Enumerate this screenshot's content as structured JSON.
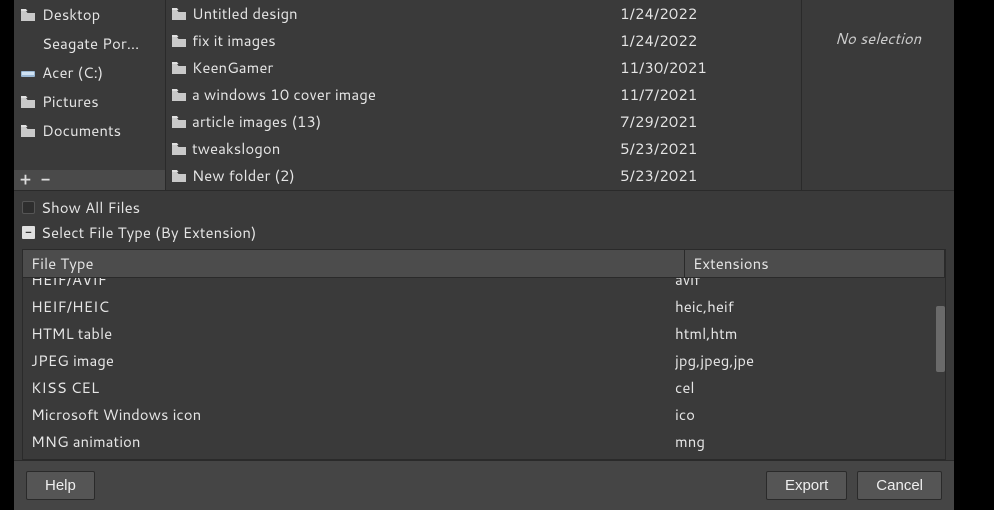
{
  "sidebar": {
    "items": [
      {
        "icon": "folder",
        "label": "Desktop"
      },
      {
        "icon": "none",
        "label": "Seagate Por…"
      },
      {
        "icon": "drive",
        "label": "Acer (C:)"
      },
      {
        "icon": "folder",
        "label": "Pictures"
      },
      {
        "icon": "folder",
        "label": "Documents"
      }
    ],
    "add_label": "+",
    "remove_label": "−"
  },
  "files": {
    "rows": [
      {
        "name": "Untitled design",
        "date": "1/24/2022"
      },
      {
        "name": "fix it images",
        "date": "1/24/2022"
      },
      {
        "name": "KeenGamer",
        "date": "11/30/2021"
      },
      {
        "name": "a windows 10 cover image",
        "date": "11/7/2021"
      },
      {
        "name": "article images (13)",
        "date": "7/29/2021"
      },
      {
        "name": "tweakslogon",
        "date": "5/23/2021"
      },
      {
        "name": "New folder (2)",
        "date": "5/23/2021"
      }
    ]
  },
  "preview": {
    "no_selection": "No selection"
  },
  "options": {
    "show_all_files_label": "Show All Files",
    "select_type_label": "Select File Type (By Extension)"
  },
  "typetable": {
    "header_name": "File Type",
    "header_ext": "Extensions",
    "rows": [
      {
        "name": "HEIF/AVIF",
        "ext": "avif"
      },
      {
        "name": "HEIF/HEIC",
        "ext": "heic,heif"
      },
      {
        "name": "HTML table",
        "ext": "html,htm"
      },
      {
        "name": "JPEG image",
        "ext": "jpg,jpeg,jpe"
      },
      {
        "name": "KISS CEL",
        "ext": "cel"
      },
      {
        "name": "Microsoft Windows icon",
        "ext": "ico"
      },
      {
        "name": "MNG animation",
        "ext": "mng"
      }
    ]
  },
  "footer": {
    "help_label": "Help",
    "export_label": "Export",
    "cancel_label": "Cancel"
  }
}
